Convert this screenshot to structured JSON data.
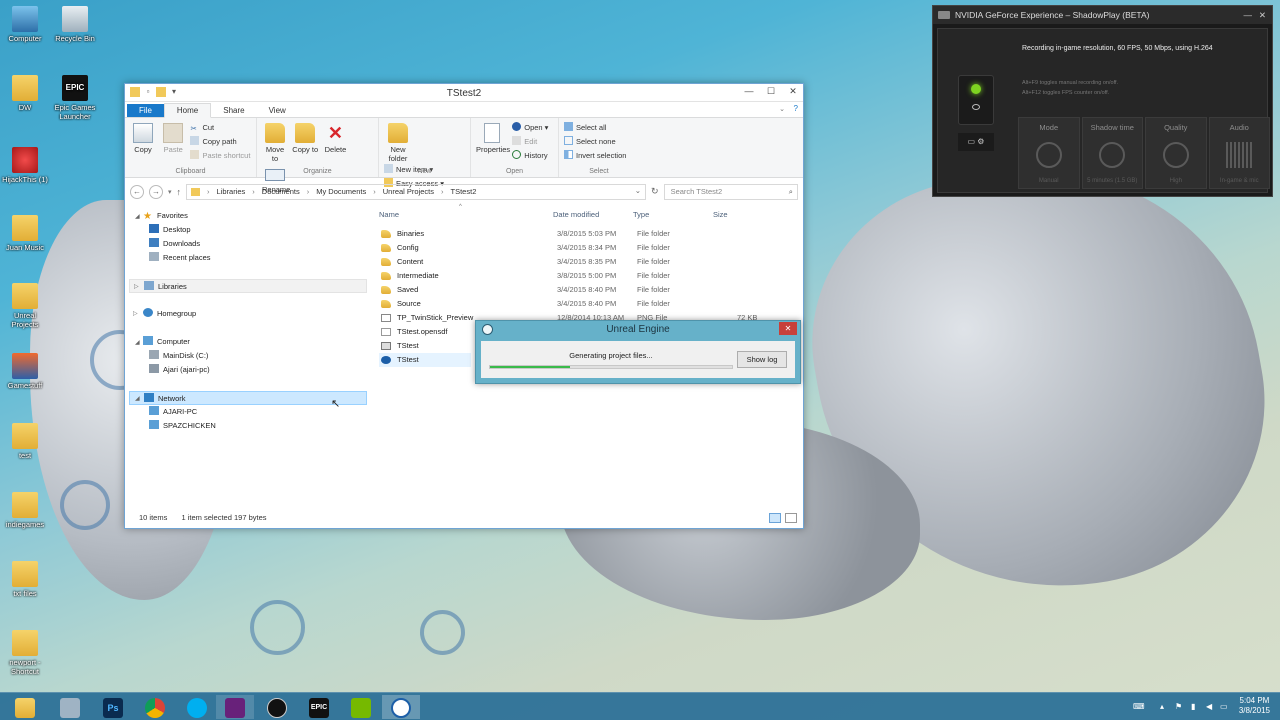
{
  "desktop": {
    "icons": [
      {
        "label": "Computer"
      },
      {
        "label": "Recycle Bin"
      },
      {
        "label": "DW"
      },
      {
        "label": "Epic Games Launcher"
      },
      {
        "label": "HijackThis (1)"
      },
      {
        "label": "Juan Music"
      },
      {
        "label": "Unreal Projects"
      },
      {
        "label": "Gamestuff"
      },
      {
        "label": "test"
      },
      {
        "label": "indiegames"
      },
      {
        "label": "txt files"
      },
      {
        "label": "newport - Shortcut"
      }
    ]
  },
  "explorer": {
    "title": "TStest2",
    "tabs": [
      "File",
      "Home",
      "Share",
      "View"
    ],
    "ribbon": {
      "clipboard": {
        "copy": "Copy",
        "paste": "Paste",
        "cut": "Cut",
        "copy_path": "Copy path",
        "paste_shortcut": "Paste shortcut",
        "label": "Clipboard"
      },
      "organize": {
        "move_to": "Move to",
        "copy_to": "Copy to",
        "delete": "Delete",
        "rename": "Rename",
        "label": "Organize"
      },
      "new": {
        "new_folder": "New folder",
        "new_item": "New item",
        "easy_access": "Easy access",
        "label": "New"
      },
      "open": {
        "properties": "Properties",
        "open": "Open",
        "edit": "Edit",
        "history": "History",
        "label": "Open"
      },
      "select": {
        "select_all": "Select all",
        "select_none": "Select none",
        "invert": "Invert selection",
        "label": "Select"
      }
    },
    "breadcrumb": [
      "Libraries",
      "Documents",
      "My Documents",
      "Unreal Projects",
      "TStest2"
    ],
    "search_placeholder": "Search TStest2",
    "nav": {
      "favorites": "Favorites",
      "desktop": "Desktop",
      "downloads": "Downloads",
      "recent": "Recent places",
      "libraries": "Libraries",
      "homegroup": "Homegroup",
      "computer": "Computer",
      "maindisk": "MainDisk (C:)",
      "ajari": "Ajari (ajari-pc)",
      "network": "Network",
      "ajari_pc": "AJARI-PC",
      "spaz": "SPAZCHICKEN"
    },
    "columns": {
      "name": "Name",
      "date": "Date modified",
      "type": "Type",
      "size": "Size"
    },
    "files": [
      {
        "name": "Binaries",
        "date": "3/8/2015 5:03 PM",
        "type": "File folder",
        "size": ""
      },
      {
        "name": "Config",
        "date": "3/4/2015 8:34 PM",
        "type": "File folder",
        "size": ""
      },
      {
        "name": "Content",
        "date": "3/4/2015 8:35 PM",
        "type": "File folder",
        "size": ""
      },
      {
        "name": "Intermediate",
        "date": "3/8/2015 5:00 PM",
        "type": "File folder",
        "size": ""
      },
      {
        "name": "Saved",
        "date": "3/4/2015 8:40 PM",
        "type": "File folder",
        "size": ""
      },
      {
        "name": "Source",
        "date": "3/4/2015 8:40 PM",
        "type": "File folder",
        "size": ""
      },
      {
        "name": "TP_TwinStick_Preview",
        "date": "12/8/2014 10:13 AM",
        "type": "PNG File",
        "size": "72 KB"
      },
      {
        "name": "TStest.opensdf",
        "date": "",
        "type": "",
        "size": ""
      },
      {
        "name": "TStest",
        "date": "",
        "type": "",
        "size": ""
      },
      {
        "name": "TStest",
        "date": "",
        "type": "",
        "size": ""
      }
    ],
    "status": {
      "count": "10 items",
      "selected": "1 item selected  197 bytes"
    }
  },
  "unreal_dialog": {
    "title": "Unreal Engine",
    "message": "Generating project files...",
    "progress": 0.33,
    "show_log": "Show log"
  },
  "nvidia": {
    "title": "NVIDIA GeForce Experience – ShadowPlay (BETA)",
    "recording": "Recording in-game resolution, 60 FPS, 50 Mbps, using H.264",
    "hint1": "Alt+F9 toggles manual recording on/off.",
    "hint2": "Alt+F12 toggles FPS counter on/off.",
    "tabs": [
      {
        "label": "Mode",
        "sub": "Manual"
      },
      {
        "label": "Shadow time",
        "sub": "5 minutes (1.5 GB)"
      },
      {
        "label": "Quality",
        "sub": "High"
      },
      {
        "label": "Audio",
        "sub": "In-game & mic"
      }
    ]
  },
  "taskbar": {
    "time": "5:04 PM",
    "date": "3/8/2015",
    "ps": "Ps",
    "epic": "EPIC"
  }
}
